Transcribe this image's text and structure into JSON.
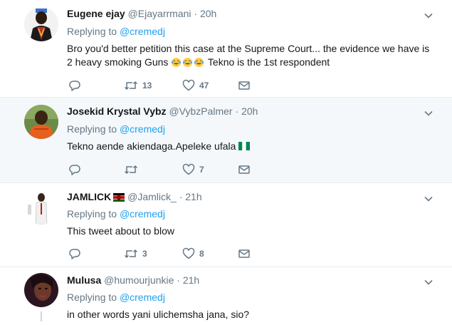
{
  "reply_prefix": "Replying to",
  "tweets": [
    {
      "name": "Eugene ejay",
      "handle": "@Ejayarrmani",
      "dot": "·",
      "time": "20h",
      "reply_to": "@cremedj",
      "text_a": "Bro you'd better petition this case at the Supreme Court... the evidence we have is 2 heavy smoking Guns",
      "text_b": " Tekno is the 1st respondent",
      "retweets": "13",
      "likes": "47"
    },
    {
      "name": "Josekid Krystal Vybz",
      "handle": "@VybzPalmer",
      "dot": "·",
      "time": "20h",
      "reply_to": "@cremedj",
      "text": "Tekno aende akiendaga.Apeleke ufala ",
      "retweets": "",
      "likes": "7"
    },
    {
      "name": "JAMLICK",
      "handle": "@Jamlick_",
      "dot": "·",
      "time": "21h",
      "reply_to": "@cremedj",
      "text": "This tweet about to blow",
      "retweets": "3",
      "likes": "8"
    },
    {
      "name": "Mulusa",
      "handle": "@humourjunkie",
      "dot": "·",
      "time": "21h",
      "reply_to": "@cremedj",
      "text": "in other words yani ulichemsha jana, sio?"
    }
  ],
  "colors": {
    "link": "#1da1f2",
    "muted": "#657786",
    "highlight_bg": "#f5f8fa"
  }
}
